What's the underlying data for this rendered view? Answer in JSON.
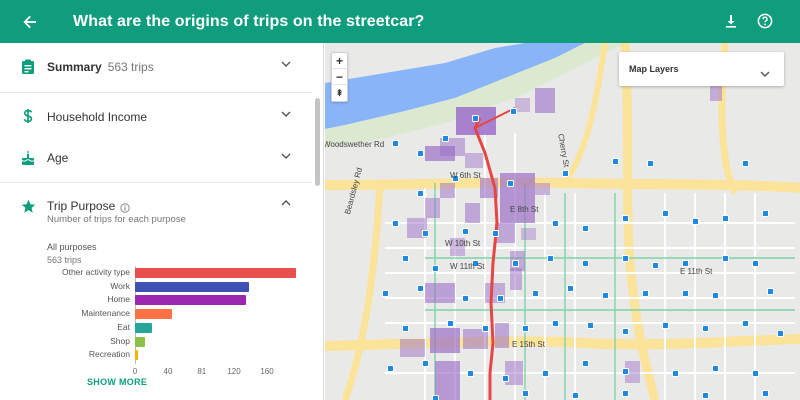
{
  "header": {
    "title": "What are the origins of trips on the streetcar?",
    "back_icon": "arrow-back-icon",
    "download_icon": "download-icon",
    "help_icon": "help-icon",
    "bg_color": "#0f9d7e"
  },
  "panel": {
    "summary": {
      "label": "Summary",
      "count": "563 trips",
      "icon": "clipboard-icon"
    },
    "income": {
      "label": "Household Income",
      "icon": "dollar-icon"
    },
    "age": {
      "label": "Age",
      "icon": "cake-icon"
    },
    "purpose": {
      "label": "Trip Purpose",
      "icon": "star-icon",
      "info_icon": "info-icon",
      "description": "Number of trips for each purpose",
      "all_label": "All purposes",
      "all_count": "563 trips",
      "show_more": "SHOW MORE"
    }
  },
  "chart_data": {
    "type": "bar",
    "orientation": "horizontal",
    "categories": [
      "Other activity type",
      "Work",
      "Home",
      "Maintenance",
      "Eat",
      "Shop",
      "Recreation"
    ],
    "values": [
      195,
      138,
      135,
      45,
      20,
      12,
      4
    ],
    "colors": [
      "#ea4f4f",
      "#3f51b5",
      "#9c27b0",
      "#ff7043",
      "#26a69a",
      "#8bc34a",
      "#ffb300"
    ],
    "xticks": [
      "0",
      "40",
      "81",
      "120",
      "160"
    ],
    "xlim": [
      0,
      200
    ]
  },
  "map": {
    "zoom_in": "+",
    "zoom_out": "−",
    "reset": "⇞",
    "layers_label": "Map Layers",
    "streets": {
      "woodswether": "Woodswether Rd",
      "beardsley": "Beardsley Rd",
      "cherry": "Cherry St",
      "w6th": "W 6th St",
      "e8th": "E 8th St",
      "w10th": "W 10th St",
      "w11th": "W 11th St",
      "e11th": "E 11th St",
      "e15th": "E 15th St"
    }
  }
}
